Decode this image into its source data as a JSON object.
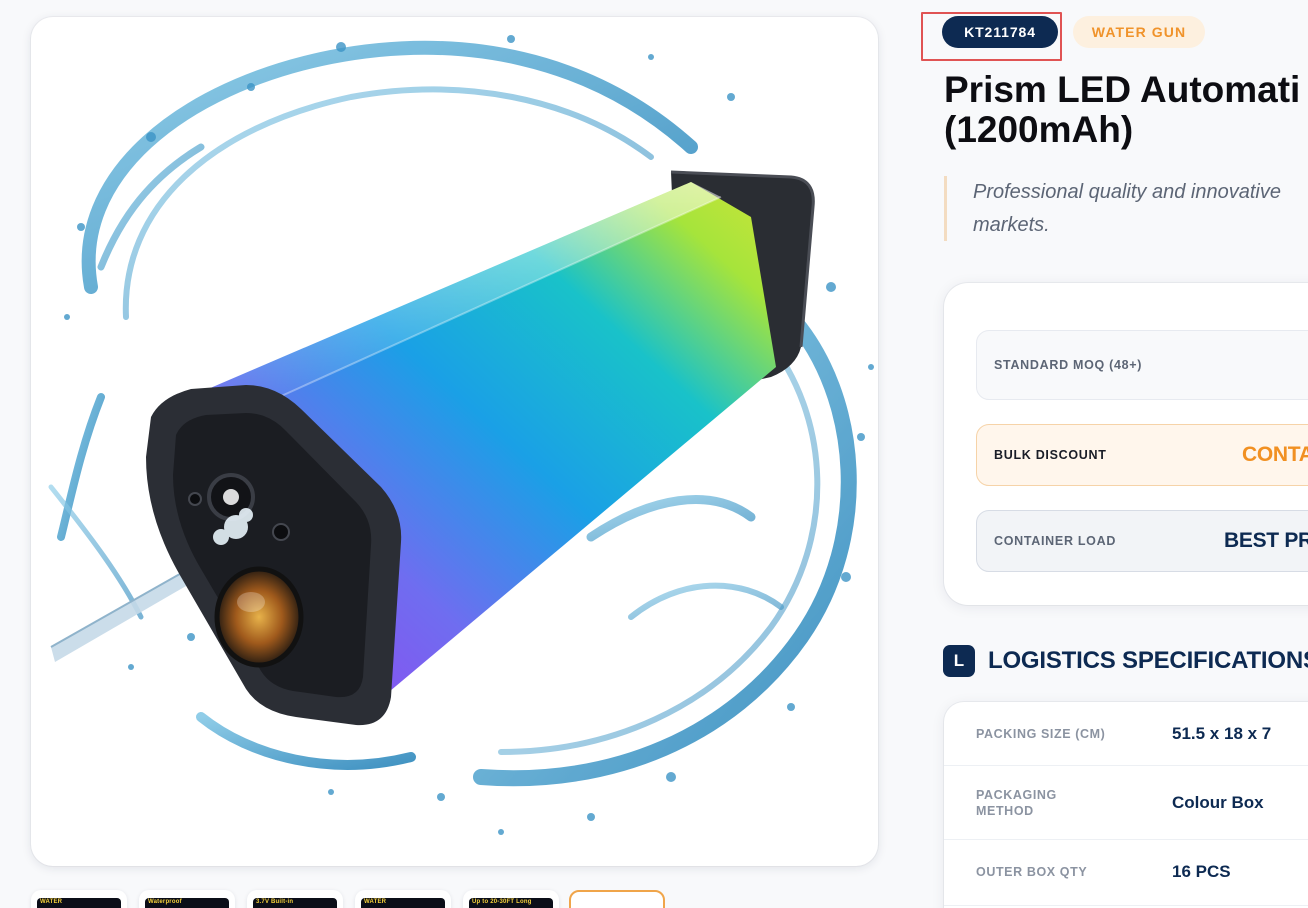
{
  "product": {
    "sku": "KT211784",
    "category": "WATER GUN",
    "title_line1": "Prism LED Automati",
    "title_line2": "(1200mAh)",
    "tagline_line1": "Professional quality and innovative",
    "tagline_line2": "markets."
  },
  "pricing": {
    "standard_label": "STANDARD MOQ (48+)",
    "bulk_label": "BULK DISCOUNT",
    "bulk_value": "CONTA",
    "container_label": "CONTAINER LOAD",
    "container_value": "BEST PRIC"
  },
  "logistics": {
    "icon_letter": "L",
    "title": "LOGISTICS SPECIFICATIONS",
    "rows": [
      {
        "key": "PACKING SIZE (CM)",
        "value": "51.5 x 18 x 7"
      },
      {
        "key": "PACKAGING METHOD",
        "value": "Colour Box"
      },
      {
        "key": "OUTER BOX QTY",
        "value": "16 PCS"
      }
    ]
  },
  "gallery": {
    "thumbnails": [
      {
        "caption": "WATER"
      },
      {
        "caption": "Waterproof"
      },
      {
        "caption": "3.7V Built-in"
      },
      {
        "caption": "WATER"
      },
      {
        "caption": "Up to 20-30FT Long"
      },
      {
        "caption": ""
      }
    ],
    "active_index": 5
  },
  "colors": {
    "navy": "#0d2a52",
    "orange": "#f0932b",
    "highlight": "#e05353"
  }
}
